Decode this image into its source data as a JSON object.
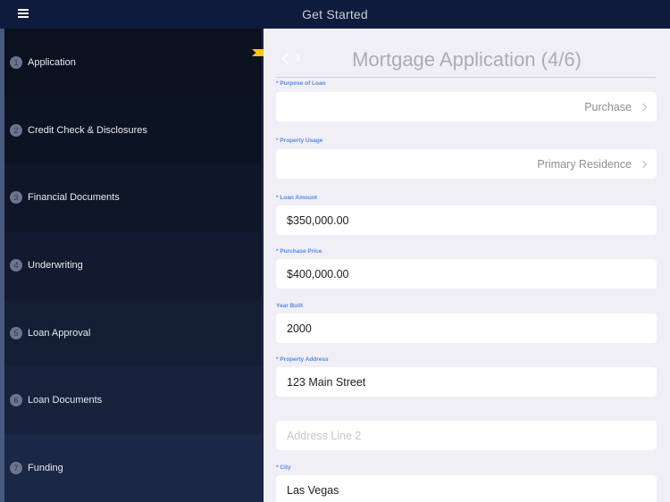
{
  "header": {
    "title": "Get Started",
    "menu_icon": "hamburger-menu-icon"
  },
  "sidebar": {
    "steps": [
      {
        "number": "1",
        "label": "Application",
        "bg": "#0b111f"
      },
      {
        "number": "2",
        "label": "Credit Check & Disclosures",
        "bg": "#0c1322"
      },
      {
        "number": "3",
        "label": "Financial Documents",
        "bg": "#0e1627"
      },
      {
        "number": "4",
        "label": "Underwriting",
        "bg": "#111a2f"
      },
      {
        "number": "5",
        "label": "Loan Approval",
        "bg": "#141f36"
      },
      {
        "number": "6",
        "label": "Loan Documents",
        "bg": "#17233d"
      },
      {
        "number": "7",
        "label": "Funding",
        "bg": "#1a2745"
      }
    ],
    "active_marker_icon": "bookmark-flag-icon"
  },
  "main": {
    "back": {
      "icon": "chevron-left-icon",
      "label": "3"
    },
    "title": "Mortgage Application (4/6)",
    "fields": {
      "purpose_of_loan": {
        "label": "* Purpose of Loan",
        "value": "Purchase"
      },
      "property_usage": {
        "label": "* Property Usage",
        "value": "Primary Residence"
      },
      "loan_amount": {
        "label": "* Loan Amount",
        "value": "$350,000.00"
      },
      "purchase_price": {
        "label": "* Purchase Price",
        "value": "$400,000.00"
      },
      "year_built": {
        "label": "Year Built",
        "value": "2000"
      },
      "property_address": {
        "label": "* Property Address",
        "value": "123 Main Street"
      },
      "address_line_2": {
        "value": "",
        "placeholder": "Address Line 2"
      },
      "city": {
        "label": "* City",
        "value": "Las Vegas"
      }
    }
  },
  "colors": {
    "header_bg": "#0e1b3c",
    "label_blue": "#5b86e5",
    "marker_yellow": "#f5c518",
    "content_bg": "#efeff5"
  }
}
